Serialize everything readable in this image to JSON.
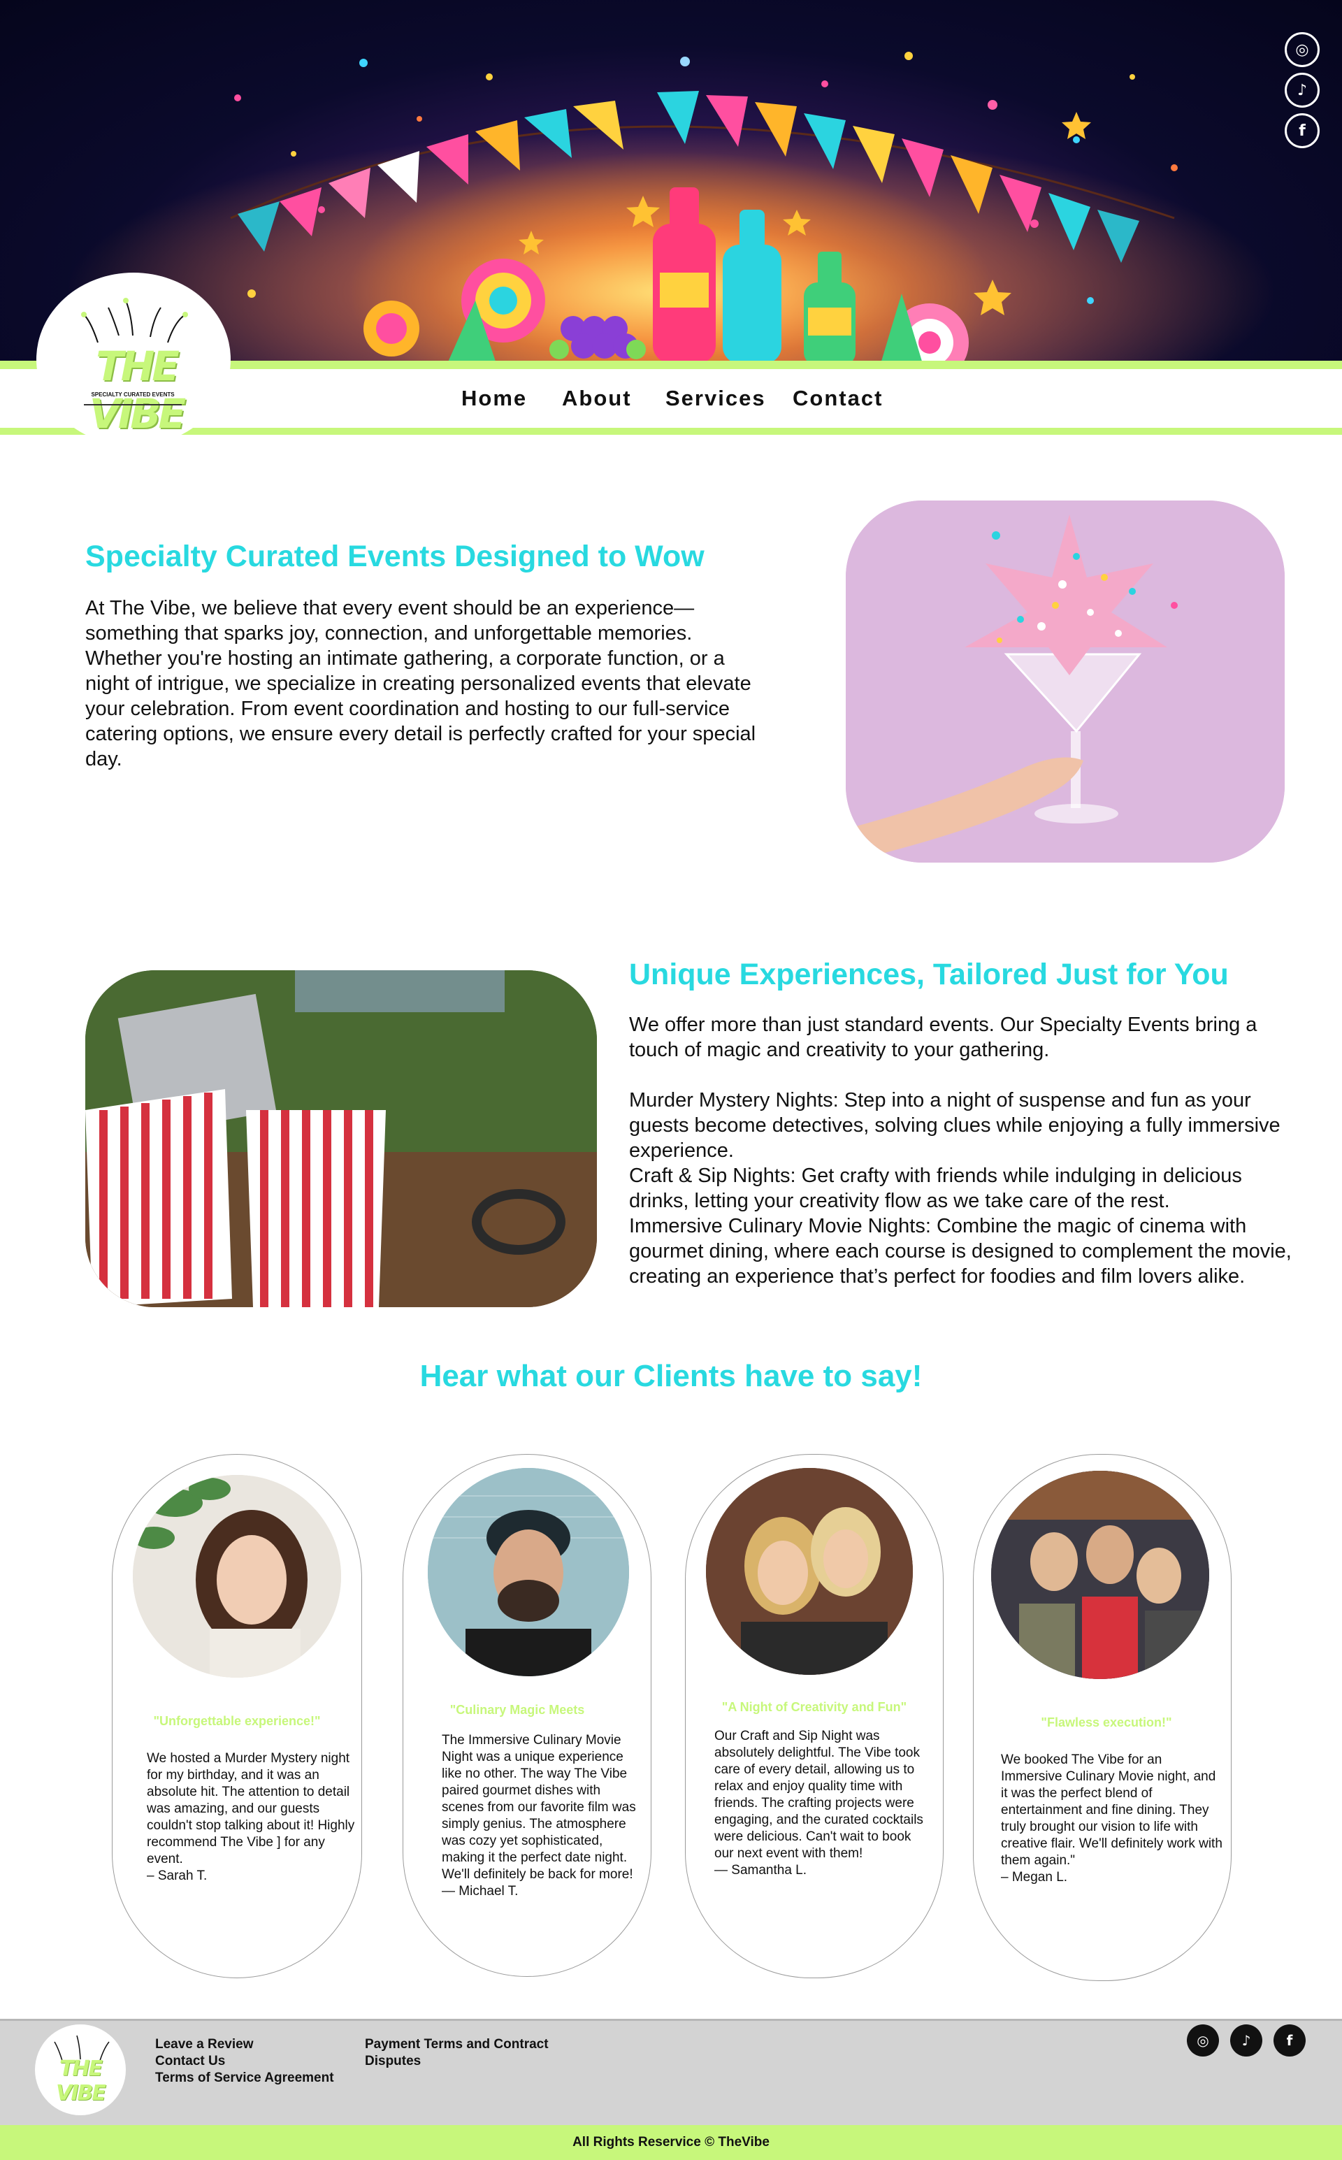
{
  "brand": {
    "logo_text": "THE VIBE",
    "logo_tagline": "SPECIALTY CURATED EVENTS",
    "lime": "#c7f77b",
    "cyan": "#28d9e0"
  },
  "social": [
    {
      "icon": "instagram-icon",
      "glyph": "◎"
    },
    {
      "icon": "tiktok-icon",
      "glyph": "♪"
    },
    {
      "icon": "facebook-icon",
      "glyph": "f"
    }
  ],
  "nav": {
    "home": "Home",
    "about": "About",
    "services": "Services",
    "contact": "Contact"
  },
  "section1": {
    "title": "Specialty Curated Events Designed to Wow",
    "body": "At The Vibe, we believe that every event should be an experience—something that sparks joy, connection, and unforgettable memories. Whether you're hosting an intimate gathering, a corporate function, or a night of intrigue, we specialize in creating personalized events that elevate your celebration. From event coordination and hosting to our full-service catering options, we ensure every detail is perfectly crafted for your special day."
  },
  "section2": {
    "title": "Unique Experiences, Tailored Just for You",
    "intro": "We offer more than just standard events. Our Specialty Events bring a touch of magic and creativity to your gathering.",
    "items": [
      "Murder Mystery Nights: Step into a night of suspense and fun as your guests become detectives, solving clues while enjoying a fully immersive experience.",
      "Craft & Sip Nights: Get crafty with friends while indulging in delicious drinks, letting your creativity flow as we take care of the rest.",
      "Immersive Culinary Movie Nights: Combine the magic of cinema with gourmet dining, where each course is designed to complement the movie, creating an experience that’s perfect for foodies and film lovers alike."
    ]
  },
  "testimonials": {
    "title": "Hear what our Clients have to say!",
    "cards": [
      {
        "quote_title": "\"Unforgettable experience!\"",
        "body": "We hosted a Murder Mystery night for my birthday, and it was an absolute hit. The attention to detail was amazing, and our guests couldn't stop talking about it! Highly recommend The Vibe ] for any event.",
        "author": "– Sarah T."
      },
      {
        "quote_title": "\"Culinary Magic Meets",
        "body": "The Immersive Culinary Movie Night was a unique experience like no other. The way The Vibe paired gourmet dishes with scenes from our favorite film was simply genius. The atmosphere was cozy yet sophisticated, making it the perfect date night. We'll definitely be back for more!",
        "author": "— Michael T."
      },
      {
        "quote_title": "\"A Night of Creativity and Fun\"",
        "body": "Our Craft and Sip Night was absolutely delightful. The Vibe took care of every detail, allowing us to relax and enjoy quality time with friends. The crafting projects were engaging, and the curated cocktails were delicious. Can't wait to book our next event with them!",
        "author": "— Samantha L."
      },
      {
        "quote_title": "\"Flawless execution!\"",
        "body": "We booked The Vibe for an Immersive Culinary Movie night, and it was the perfect blend of entertainment and fine dining. They truly brought our vision to life with creative flair. We'll definitely work with them again.\"",
        "author": "– Megan L."
      }
    ]
  },
  "footer": {
    "links_col1": [
      "Leave a Review",
      "Contact Us",
      "Terms of Service Agreement"
    ],
    "links_col2": [
      "Payment Terms and Contract",
      "Disputes"
    ],
    "copyright": "All Rights Reservice © TheVibe"
  }
}
